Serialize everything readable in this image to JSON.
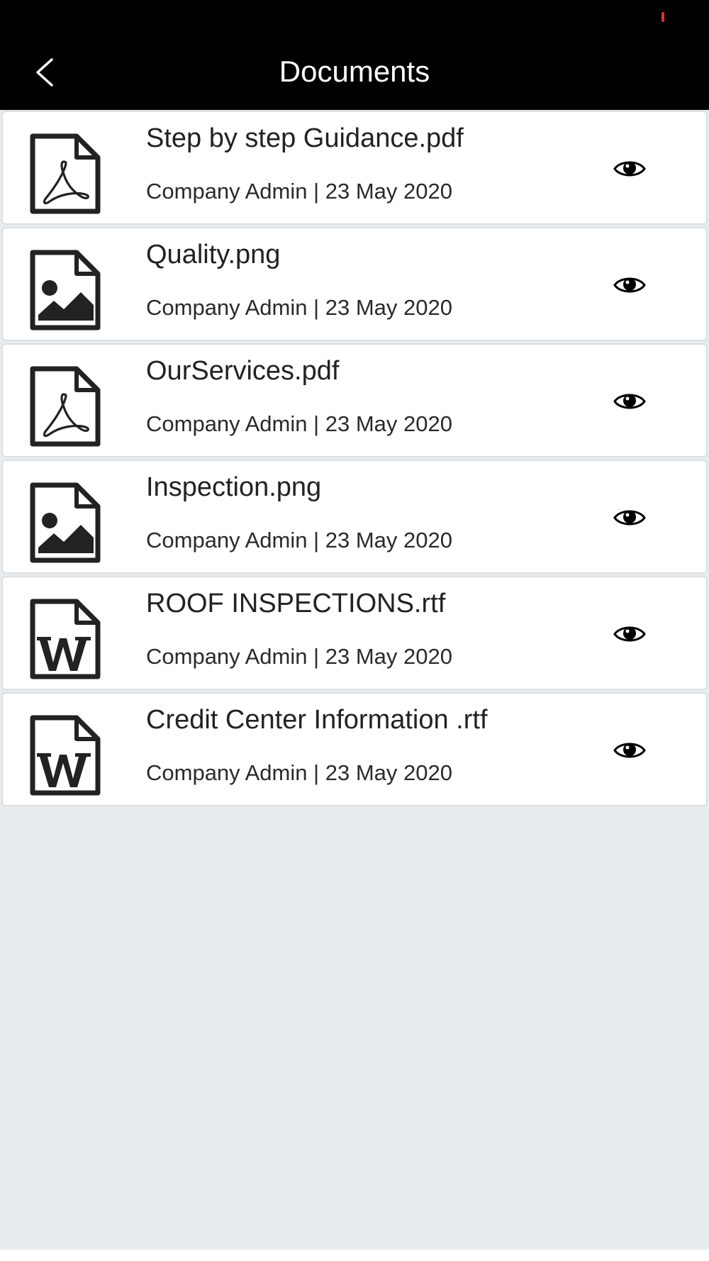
{
  "header": {
    "title": "Documents",
    "back_icon": "chevron-left-icon",
    "background": "#000000",
    "title_color": "#ffffff",
    "status_indicator_color": "#e03131"
  },
  "documents": [
    {
      "name": "Step by step Guidance.pdf",
      "meta": "Company Admin | 23 May 2020",
      "icon": "pdf-file-icon",
      "action_icon": "eye-icon"
    },
    {
      "name": "Quality.png",
      "meta": "Company Admin | 23 May 2020",
      "icon": "image-file-icon",
      "action_icon": "eye-icon"
    },
    {
      "name": "OurServices.pdf",
      "meta": "Company Admin | 23 May 2020",
      "icon": "pdf-file-icon",
      "action_icon": "eye-icon"
    },
    {
      "name": "Inspection.png",
      "meta": "Company Admin | 23 May 2020",
      "icon": "image-file-icon",
      "action_icon": "eye-icon"
    },
    {
      "name": "ROOF INSPECTIONS.rtf",
      "meta": "Company Admin | 23 May 2020",
      "icon": "word-file-icon",
      "action_icon": "eye-icon"
    },
    {
      "name": "Credit Center Information .rtf",
      "meta": "Company Admin | 23 May 2020",
      "icon": "word-file-icon",
      "action_icon": "eye-icon"
    }
  ],
  "colors": {
    "page_background": "#e8ecef",
    "card_background": "#ffffff",
    "card_border": "#dcdfe2",
    "icon_color": "#222222"
  }
}
